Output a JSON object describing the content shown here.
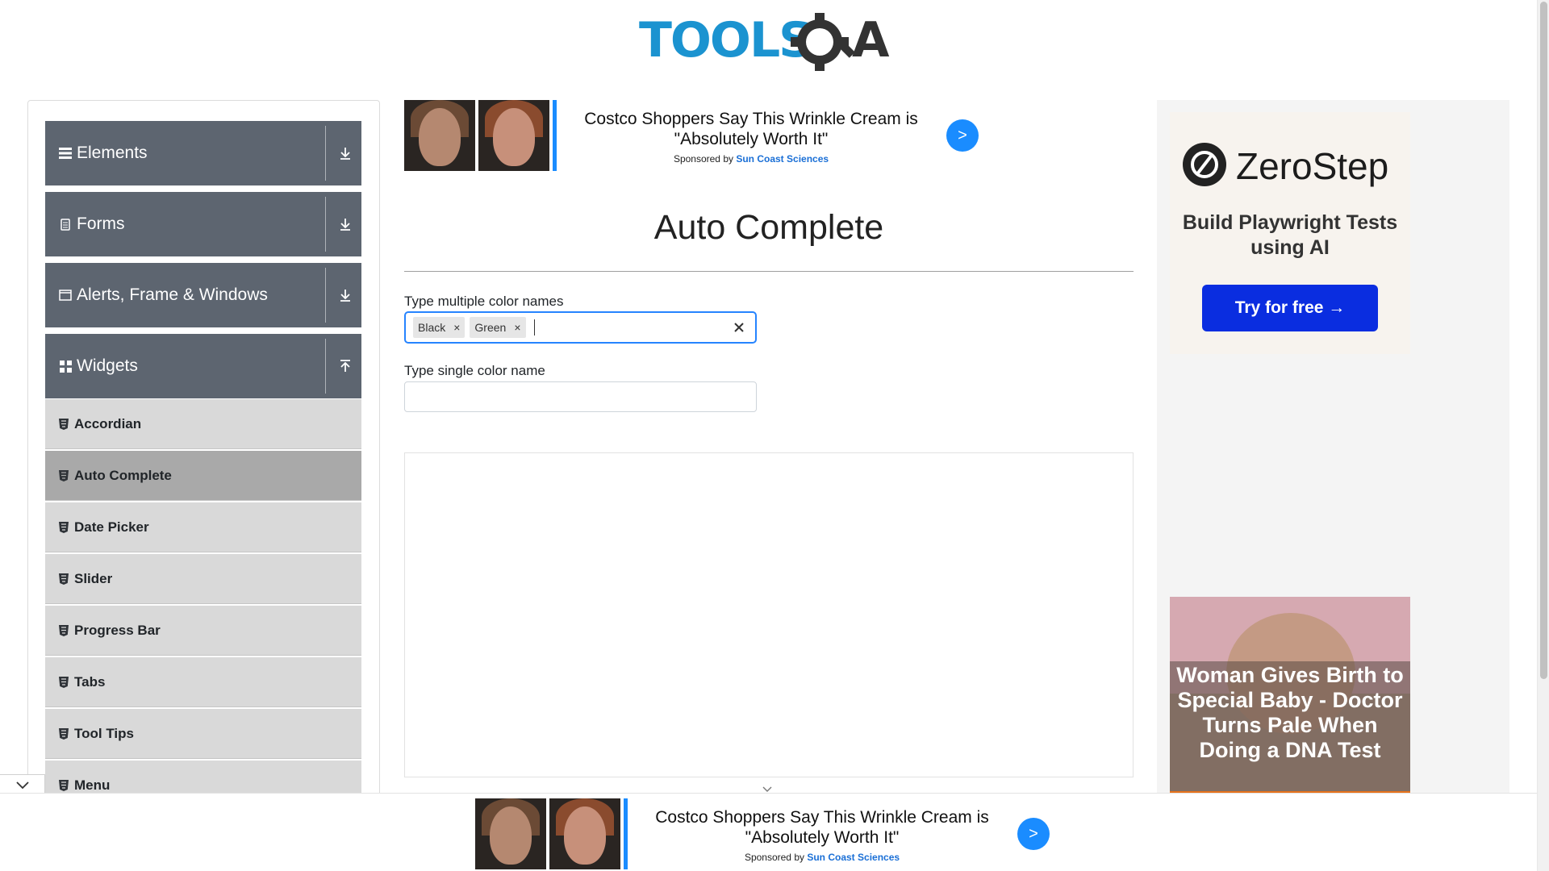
{
  "header": {
    "logo_text": "TOOLSQA"
  },
  "sidebar": {
    "groups": [
      {
        "label": "Elements",
        "icon": "hamburger-icon",
        "state": "collapsed"
      },
      {
        "label": "Forms",
        "icon": "form-icon",
        "state": "collapsed"
      },
      {
        "label": "Alerts, Frame & Windows",
        "icon": "window-icon",
        "state": "collapsed"
      },
      {
        "label": "Widgets",
        "icon": "grid-icon",
        "state": "expanded"
      }
    ],
    "items": [
      {
        "label": "Accordian"
      },
      {
        "label": "Auto Complete",
        "active": true
      },
      {
        "label": "Date Picker"
      },
      {
        "label": "Slider"
      },
      {
        "label": "Progress Bar"
      },
      {
        "label": "Tabs"
      },
      {
        "label": "Tool Tips"
      },
      {
        "label": "Menu"
      }
    ]
  },
  "ad_top": {
    "title": "Costco Shoppers Say This Wrinkle Cream is \"Absolutely Worth It\"",
    "sponsored_prefix": "Sponsored by",
    "sponsor": "Sun Coast Sciences",
    "go_label": ">"
  },
  "main": {
    "title": "Auto Complete",
    "multi_label": "Type multiple color names",
    "multi_chips": [
      "Black",
      "Green"
    ],
    "chip_remove": "×",
    "single_label": "Type single color name",
    "single_value": ""
  },
  "right_ads": {
    "zerostep_name": "ZeroStep",
    "zerostep_tagline": "Build Playwright Tests using AI",
    "zerostep_button": "Try for free →",
    "baby_headline": "Woman Gives Birth to Special Baby - Doctor Turns Pale When Doing a DNA Test"
  },
  "ad_bottom": {
    "title": "Costco Shoppers Say This Wrinkle Cream is \"Absolutely Worth It\"",
    "sponsored_prefix": "Sponsored by",
    "sponsor": "Sun Coast Sciences",
    "go_label": ">"
  },
  "colors": {
    "sidebar_header": "#5d6570",
    "sidebar_item": "#d9d9d9",
    "sidebar_item_active": "#a9a9a9",
    "focus_border": "#2684ff",
    "logo_blue": "#1b93d0",
    "logo_dark": "#333333"
  }
}
